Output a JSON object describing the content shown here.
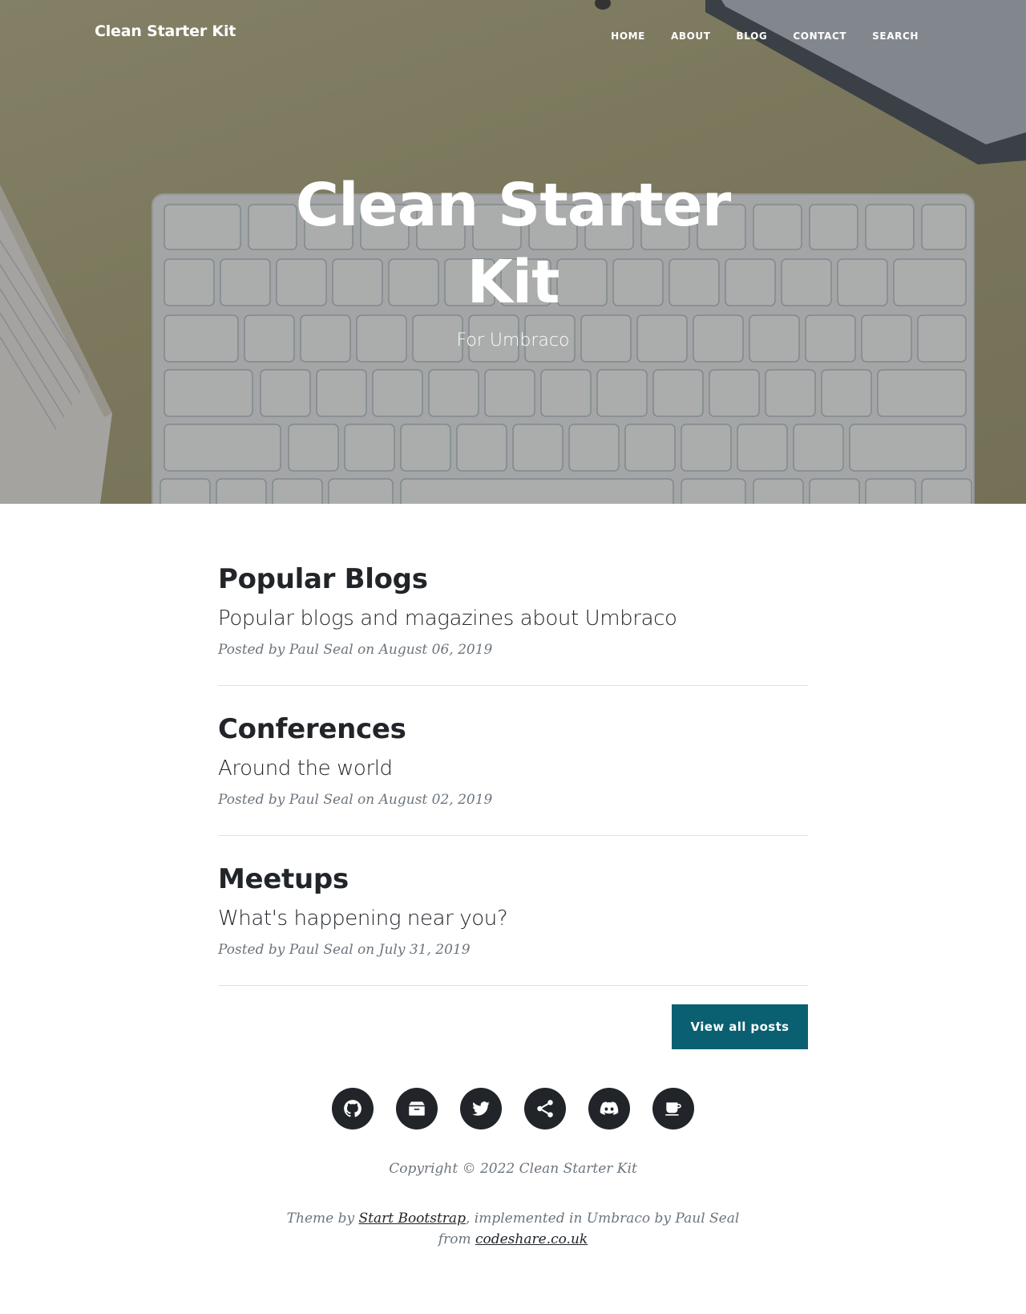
{
  "nav": {
    "brand": "Clean Starter Kit",
    "links": [
      "HOME",
      "ABOUT",
      "BLOG",
      "CONTACT",
      "SEARCH"
    ]
  },
  "hero": {
    "title": "Clean Starter Kit",
    "subtitle": "For Umbraco"
  },
  "posts": [
    {
      "title": "Popular Blogs",
      "subtitle": "Popular blogs and magazines about Umbraco",
      "meta": "Posted by Paul Seal on August 06, 2019"
    },
    {
      "title": "Conferences",
      "subtitle": "Around the world",
      "meta": "Posted by Paul Seal on August 02, 2019"
    },
    {
      "title": "Meetups",
      "subtitle": "What's happening near you?",
      "meta": "Posted by Paul Seal on July 31, 2019"
    }
  ],
  "pager": {
    "view_all_label": "View all posts"
  },
  "footer": {
    "social_icons": [
      "github-icon",
      "package-box-icon",
      "twitter-icon",
      "share-icon",
      "discord-icon",
      "coffee-cup-icon"
    ],
    "copyright": "Copyright © 2022 Clean Starter Kit",
    "credits_prefix": "Theme by ",
    "credits_link1": "Start Bootstrap",
    "credits_middle": ", implemented in Umbraco by Paul Seal from ",
    "credits_link2": "codeshare.co.uk"
  },
  "colors": {
    "accent": "#0a5f70",
    "text": "#212529",
    "muted": "#6c757d"
  }
}
